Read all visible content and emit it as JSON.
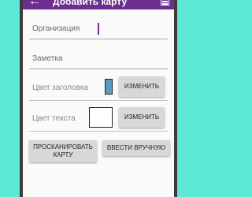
{
  "appbar": {
    "title": "Добавить карту",
    "back_icon": "arrow-left-icon",
    "menu_icon": "cards-icon",
    "color": "#6c2f90"
  },
  "form": {
    "organization_label": "Организация",
    "note_label": "Заметка",
    "header_color_label": "Цвет заголовка",
    "header_color_value": "#5a9bbf",
    "text_color_label": "Цвет текста",
    "text_color_value": "#ffffff",
    "change_label": "ИЗМЕНИТЬ"
  },
  "actions": {
    "scan_label": "ПРОСКАНИРОВАТЬ КАРТУ",
    "manual_label": "ВВЕСТИ ВРУЧНУЮ"
  }
}
